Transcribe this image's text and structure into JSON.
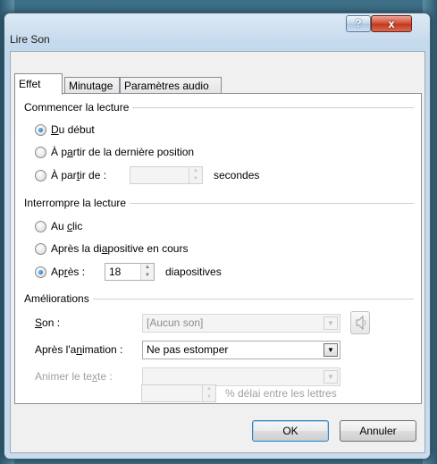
{
  "window": {
    "title": "Lire Son",
    "help_label": "?",
    "close_label": "x"
  },
  "tabs": [
    {
      "label": "Effet",
      "active": true
    },
    {
      "label": "Minutage",
      "active": false
    },
    {
      "label": "Paramètres audio",
      "active": false
    }
  ],
  "start": {
    "title": "Commencer la lecture",
    "opt_beginning": {
      "pre": "",
      "key": "D",
      "post": "u début",
      "checked": true
    },
    "opt_last": {
      "pre": "À p",
      "key": "a",
      "post": "rtir de la dernière position",
      "checked": false
    },
    "opt_from": {
      "pre": "À par",
      "key": "t",
      "post": "ir de :",
      "checked": false
    },
    "from_value": "",
    "seconds_label": "secondes"
  },
  "stop": {
    "title": "Interrompre la lecture",
    "opt_click": {
      "pre": "Au ",
      "key": "c",
      "post": "lic",
      "checked": false
    },
    "opt_after_slide": {
      "pre": "Après la di",
      "key": "a",
      "post": "positive en cours",
      "checked": false
    },
    "opt_after": {
      "pre": "Ap",
      "key": "r",
      "post": "ès :",
      "checked": true
    },
    "after_value": "18",
    "slides_label": "diapositives"
  },
  "enhancements": {
    "title": "Améliorations",
    "sound_label_key": "S",
    "sound_label_rest": "on :",
    "sound_value": "[Aucun son]",
    "after_anim_pre": "Après l'a",
    "after_anim_key": "n",
    "after_anim_post": "imation :",
    "after_anim_value": "Ne pas estomper",
    "animate_text_pre": "Animer le te",
    "animate_text_key": "x",
    "animate_text_post": "te :",
    "animate_text_value": "",
    "delay_value": "",
    "delay_label": "% délai entre les lettres"
  },
  "buttons": {
    "ok": "OK",
    "cancel": "Annuler"
  }
}
